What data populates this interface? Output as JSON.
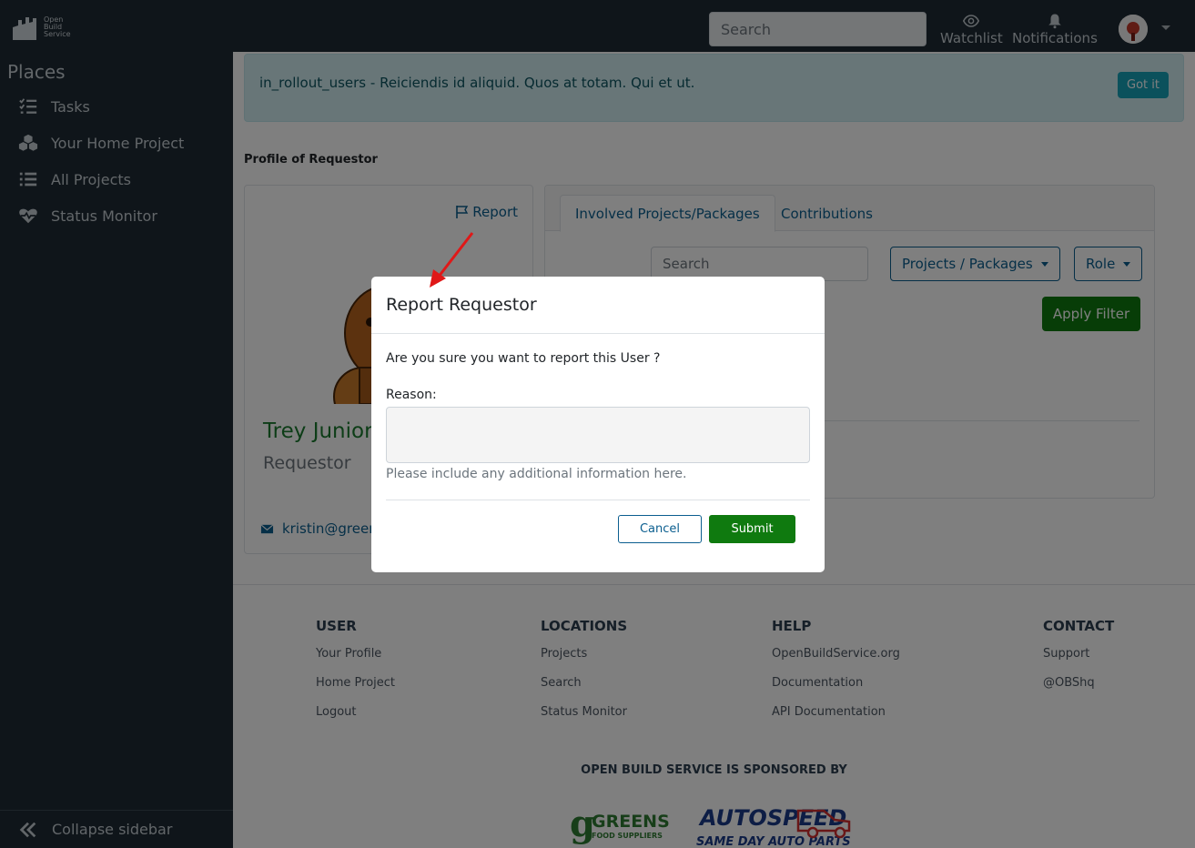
{
  "brand": {
    "logo_lines": [
      "Open",
      "Build",
      "Service"
    ]
  },
  "topbar": {
    "search_placeholder": "Search",
    "watchlist_label": "Watchlist",
    "notifications_label": "Notifications"
  },
  "sidebar": {
    "heading": "Places",
    "items": [
      {
        "label": "Tasks",
        "icon": "tasks-icon"
      },
      {
        "label": "Your Home Project",
        "icon": "cubes-icon"
      },
      {
        "label": "All Projects",
        "icon": "list-icon"
      },
      {
        "label": "Status Monitor",
        "icon": "heartbeat-icon"
      }
    ],
    "collapse_label": "Collapse sidebar"
  },
  "alert": {
    "text": "in_rollout_users - Reiciendis id aliquid. Quos at totam. Qui et ut.",
    "button": "Got it"
  },
  "profile": {
    "section_title": "Profile of Requestor",
    "report_label": "Report",
    "name": "Trey Junior",
    "role": "Requestor",
    "email": "kristin@green"
  },
  "tabs": {
    "items": [
      "Involved Projects/Packages",
      "Contributions"
    ],
    "search_placeholder": "Search",
    "projects_dropdown": "Projects / Packages",
    "role_dropdown": "Role",
    "apply_button": "Apply Filter"
  },
  "modal": {
    "title": "Report Requestor",
    "question": "Are you sure you want to report this User ?",
    "reason_label": "Reason:",
    "help_text": "Please include any additional information here.",
    "cancel": "Cancel",
    "submit": "Submit"
  },
  "footer": {
    "columns": [
      {
        "heading": "USER",
        "links": [
          "Your Profile",
          "Home Project",
          "Logout"
        ]
      },
      {
        "heading": "LOCATIONS",
        "links": [
          "Projects",
          "Search",
          "Status Monitor"
        ]
      },
      {
        "heading": "HELP",
        "links": [
          "OpenBuildService.org",
          "Documentation",
          "API Documentation"
        ]
      },
      {
        "heading": "CONTACT",
        "links": [
          "Support",
          "@OBShq"
        ]
      }
    ],
    "sponsor_title": "OPEN BUILD SERVICE IS SPONSORED BY",
    "sponsors": [
      {
        "name": "GREENS",
        "sub": "FOOD SUPPLIERS"
      },
      {
        "name": "AUTOSPEED",
        "sub": "SAME DAY AUTO PARTS"
      }
    ]
  },
  "colors": {
    "sidebar_bg": "#1f2b34",
    "link": "#0b5e8f",
    "success": "#0f7a0f",
    "alert_bg": "#d1ecf1"
  }
}
